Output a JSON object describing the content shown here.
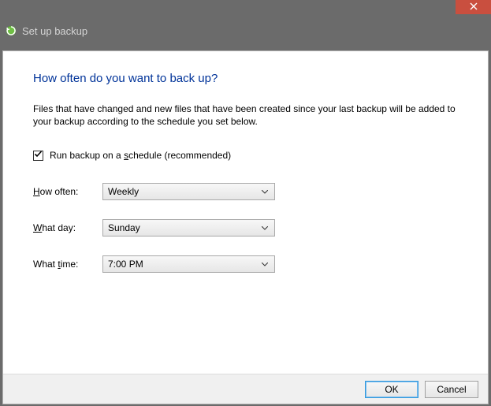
{
  "titlebar": {
    "close_icon": "close"
  },
  "wizard": {
    "title": "Set up backup"
  },
  "dialog": {
    "heading": "How often do you want to back up?",
    "description": "Files that have changed and new files that have been created since your last backup will be added to your backup according to the schedule you set below.",
    "schedule_checkbox": {
      "checked": true,
      "prefix": "Run backup on a ",
      "underlined": "s",
      "suffix": "chedule (recommended)"
    },
    "fields": {
      "how_often": {
        "label_prefix_ul": "H",
        "label_rest": "ow often:",
        "value": "Weekly"
      },
      "what_day": {
        "label_prefix_ul": "W",
        "label_rest": "hat day:",
        "value": "Sunday"
      },
      "what_time": {
        "label_prefix": "What ",
        "label_ul": "t",
        "label_rest": "ime:",
        "value": "7:00 PM"
      }
    },
    "buttons": {
      "ok": "OK",
      "cancel": "Cancel"
    }
  }
}
